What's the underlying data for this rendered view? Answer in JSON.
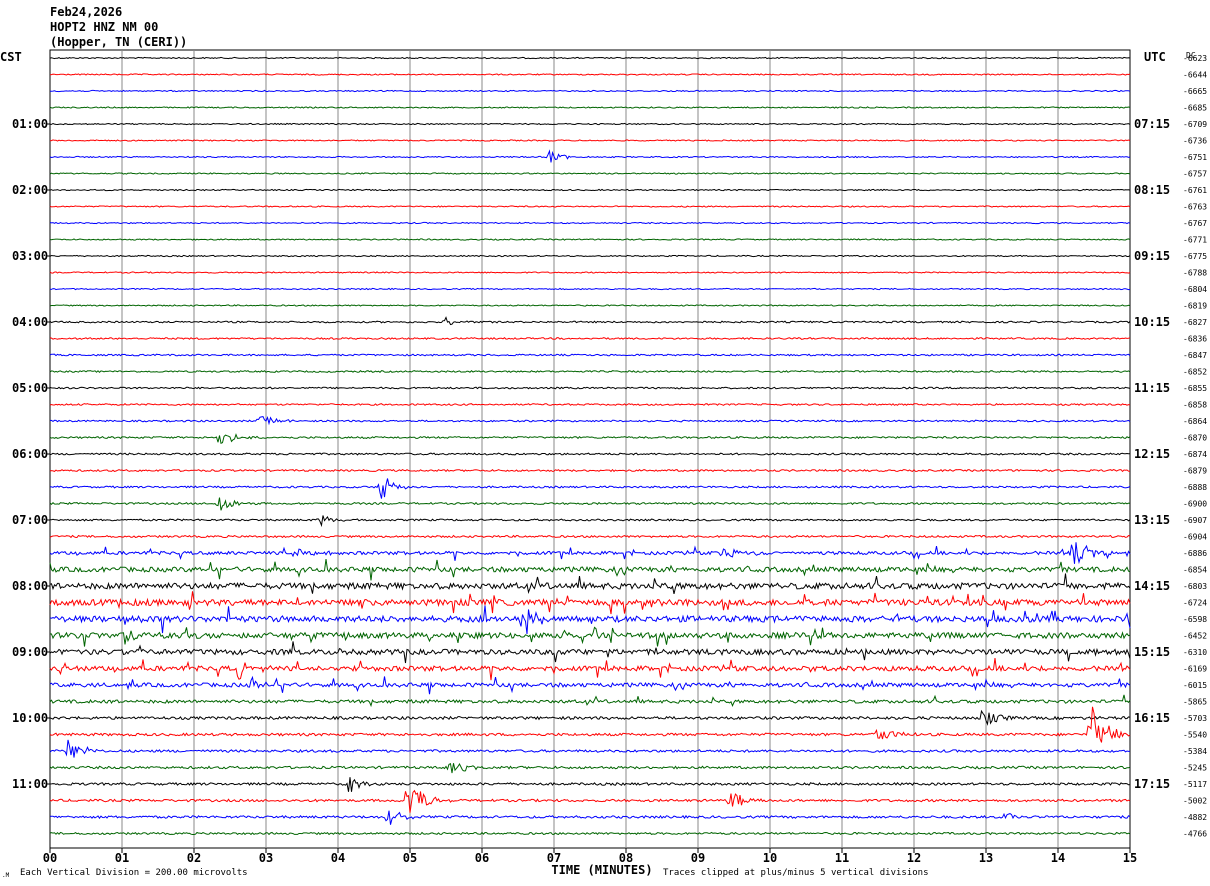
{
  "header": {
    "date": "Feb24,2026",
    "station": "HOPT2 HNZ NM 00",
    "location": "(Hopper, TN (CERI))"
  },
  "labels": {
    "left_tz": "CST",
    "right_tz": "UTC",
    "dc": "DC"
  },
  "footer": {
    "scale_note": "Each Vertical Division =  200.00 microvolts",
    "xlabel": "TIME (MINUTES)",
    "clip_note": "Traces clipped at plus/minus 5 vertical divisions"
  },
  "chart_data": {
    "type": "line",
    "title": "HOPT2 HNZ NM 00",
    "xlabel": "TIME (MINUTES)",
    "x_ticks": [
      "00",
      "01",
      "02",
      "03",
      "04",
      "05",
      "06",
      "07",
      "08",
      "09",
      "10",
      "11",
      "12",
      "13",
      "14",
      "15"
    ],
    "xlim": [
      0,
      15
    ],
    "grid": true,
    "trace_colors": [
      "#000000",
      "#ff0000",
      "#0000ff",
      "#006400"
    ],
    "left_hour_labels": [
      "01:00",
      "02:00",
      "03:00",
      "04:00",
      "05:00",
      "06:00",
      "07:00",
      "08:00",
      "09:00",
      "10:00",
      "11:00"
    ],
    "right_hour_labels": [
      "07:15",
      "08:15",
      "09:15",
      "10:15",
      "11:15",
      "12:15",
      "13:15",
      "14:15",
      "15:15",
      "16:15",
      "17:15"
    ],
    "dc_offsets": [
      "-6623",
      "-6644",
      "-6665",
      "-6685",
      "-6709",
      "-6736",
      "-6751",
      "-6757",
      "-6761",
      "-6763",
      "-6767",
      "-6771",
      "-6775",
      "-6788",
      "-6804",
      "-6819",
      "-6827",
      "-6836",
      "-6847",
      "-6852",
      "-6855",
      "-6858",
      "-6864",
      "-6870",
      "-6874",
      "-6879",
      "-6888",
      "-6900",
      "-6907",
      "-6904",
      "-6886",
      "-6854",
      "-6803",
      "-6724",
      "-6598",
      "-6452",
      "-6310",
      "-6169",
      "-6015",
      "-5865",
      "-5703",
      "-5540",
      "-5384",
      "-5245",
      "-5117",
      "-5002",
      "-4882",
      "-4766"
    ],
    "noise_levels": [
      0.6,
      0.6,
      0.6,
      0.6,
      0.6,
      0.6,
      0.6,
      0.6,
      0.6,
      0.6,
      0.6,
      0.6,
      0.6,
      0.6,
      0.6,
      0.6,
      0.8,
      0.8,
      0.8,
      0.8,
      0.8,
      0.8,
      0.8,
      0.9,
      0.9,
      0.9,
      0.9,
      0.9,
      0.9,
      1.0,
      1.6,
      2.4,
      3.0,
      3.0,
      3.0,
      2.8,
      2.6,
      2.4,
      2.0,
      1.6,
      1.4,
      1.3,
      1.2,
      1.2,
      1.2,
      1.2,
      1.2,
      1.0
    ],
    "events": [
      {
        "trace": 6,
        "minute": 6.93,
        "amp": 7
      },
      {
        "trace": 16,
        "minute": 5.5,
        "amp": 5
      },
      {
        "trace": 23,
        "minute": 2.35,
        "amp": 10
      },
      {
        "trace": 22,
        "minute": 2.92,
        "amp": 9
      },
      {
        "trace": 26,
        "minute": 4.6,
        "amp": 16
      },
      {
        "trace": 27,
        "minute": 2.35,
        "amp": 11
      },
      {
        "trace": 28,
        "minute": 3.75,
        "amp": 6
      },
      {
        "trace": 30,
        "minute": 3.4,
        "amp": 8
      },
      {
        "trace": 30,
        "minute": 9.35,
        "amp": 9
      },
      {
        "trace": 30,
        "minute": 14.2,
        "amp": 20
      },
      {
        "trace": 33,
        "minute": 8.25,
        "amp": 12
      },
      {
        "trace": 34,
        "minute": 6.55,
        "amp": 14
      },
      {
        "trace": 37,
        "minute": 2.6,
        "amp": 12
      },
      {
        "trace": 38,
        "minute": 2.75,
        "amp": 9
      },
      {
        "trace": 40,
        "minute": 12.95,
        "amp": 10
      },
      {
        "trace": 41,
        "minute": 11.5,
        "amp": 10
      },
      {
        "trace": 41,
        "minute": 14.45,
        "amp": 38
      },
      {
        "trace": 42,
        "minute": 0.25,
        "amp": 14
      },
      {
        "trace": 43,
        "minute": 5.55,
        "amp": 9
      },
      {
        "trace": 44,
        "minute": 4.15,
        "amp": 9
      },
      {
        "trace": 45,
        "minute": 4.97,
        "amp": 30
      },
      {
        "trace": 45,
        "minute": 9.45,
        "amp": 12
      },
      {
        "trace": 46,
        "minute": 4.7,
        "amp": 10
      },
      {
        "trace": 46,
        "minute": 13.25,
        "amp": 5
      }
    ]
  }
}
